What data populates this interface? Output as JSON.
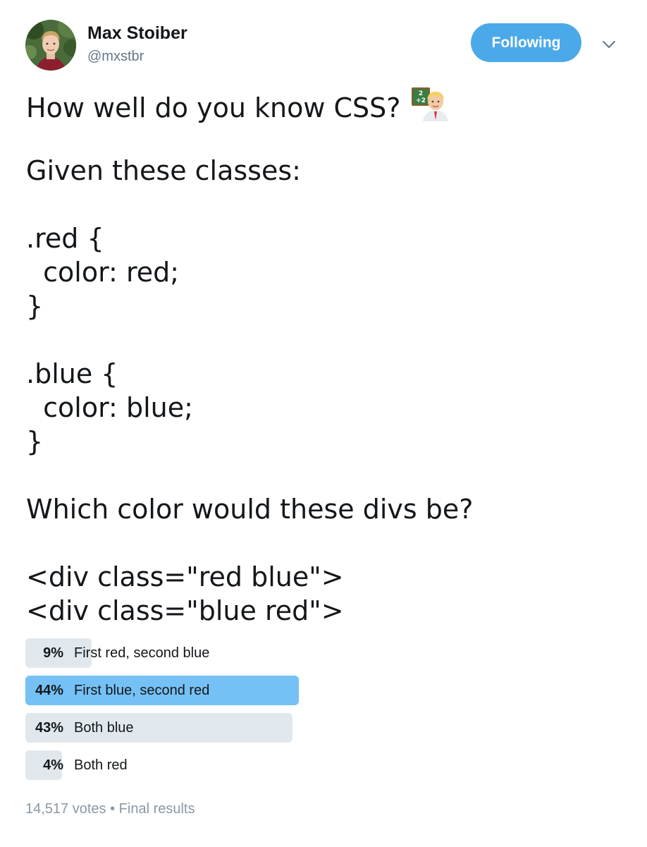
{
  "author": {
    "name": "Max Stoiber",
    "handle": "@mxstbr"
  },
  "follow_button": {
    "label": "Following",
    "color": "#4ba9ea"
  },
  "menu": {
    "icon": "chevron-down-icon"
  },
  "tweet": {
    "line1": "How well do you know CSS?",
    "line1_emoji": "teacher-emoji",
    "line2": "Given these classes:",
    "line3": ".red {",
    "line4": "  color: red;",
    "line5": "}",
    "line6": ".blue {",
    "line7": "  color: blue;",
    "line8": "}",
    "line9": "Which color would these divs be?",
    "line10": "<div class=\"red blue\">",
    "line11": "<div class=\"blue red\">"
  },
  "poll": {
    "options": [
      {
        "percent": "9%",
        "value": 9,
        "label": "First red, second blue",
        "winner": false
      },
      {
        "percent": "44%",
        "value": 44,
        "label": "First blue, second red",
        "winner": true
      },
      {
        "percent": "43%",
        "value": 43,
        "label": "Both blue",
        "winner": false
      },
      {
        "percent": "4%",
        "value": 4,
        "label": "Both red",
        "winner": false
      }
    ],
    "votes": "14,517 votes",
    "separator": "•",
    "status": "Final results",
    "winner_color": "#75c1f5",
    "bar_color": "#e1e8ed"
  }
}
